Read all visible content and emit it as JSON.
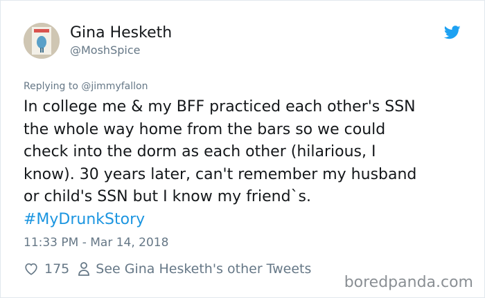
{
  "author": {
    "name": "Gina Hesketh",
    "handle": "@MoshSpice"
  },
  "replying_to": {
    "prefix": "Replying to",
    "handle": "@jimmyfallon"
  },
  "tweet": {
    "lines": [
      "In college me & my BFF practiced each other's SSN",
      "the whole way home from the bars so we could",
      "check into the dorm as each other (hilarious, I",
      "know). 30 years later, can't remember my husband",
      "or child's SSN but I know my friend`s."
    ],
    "hashtag": "#MyDrunkStory",
    "timestamp": "11:33 PM - Mar 14, 2018"
  },
  "actions": {
    "likes": "175",
    "profile_link": "See Gina Hesketh's other Tweets"
  },
  "watermark": "boredpanda.com",
  "icons": {
    "brand": "twitter-bird-icon",
    "like": "heart-icon",
    "profile": "person-icon"
  },
  "colors": {
    "hashtag": "#1b95e0",
    "twitter_blue": "#1da1f2",
    "secondary_text": "#657786"
  }
}
